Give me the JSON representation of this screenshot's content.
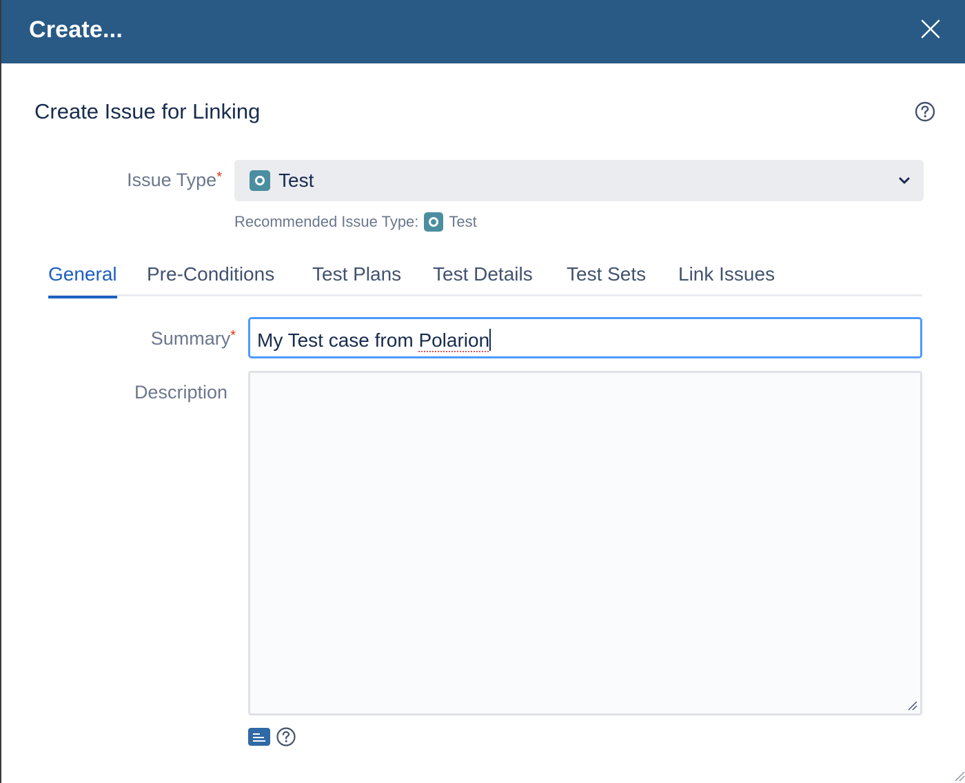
{
  "header": {
    "title": "Create..."
  },
  "dialog": {
    "subtitle": "Create Issue for Linking"
  },
  "issue_type": {
    "label": "Issue Type",
    "required_mark": "*",
    "value": "Test",
    "icon": "test-issue-type-icon",
    "recommended_label": "Recommended Issue Type:",
    "recommended_value": "Test"
  },
  "tabs": [
    {
      "label": "General",
      "active": true
    },
    {
      "label": "Pre-Conditions"
    },
    {
      "label": "Test Plans"
    },
    {
      "label": "Test Details"
    },
    {
      "label": "Test Sets"
    },
    {
      "label": "Link Issues"
    }
  ],
  "summary": {
    "label": "Summary",
    "required_mark": "*",
    "value_plain": "My Test case from ",
    "value_misspelled": "Polarion"
  },
  "description": {
    "label": "Description",
    "value": ""
  },
  "colors": {
    "header_bg": "#285a85",
    "accent": "#1d5ec1",
    "focus_border": "#4c9aff",
    "required": "#de350b"
  }
}
